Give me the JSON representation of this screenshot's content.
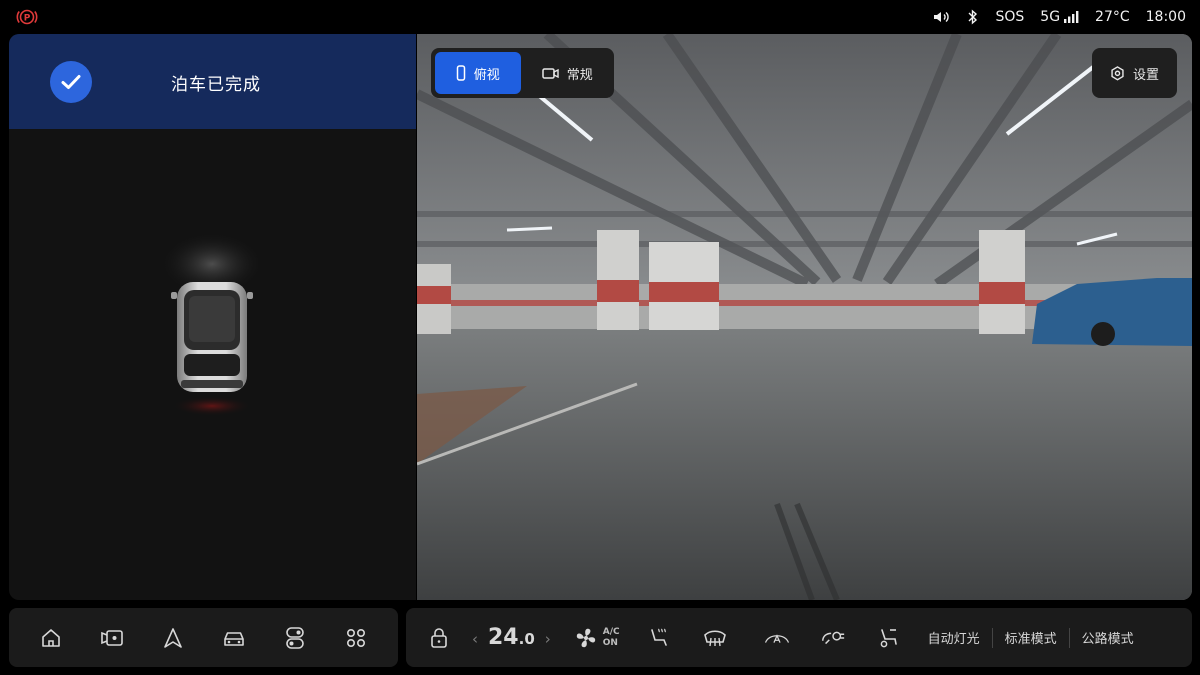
{
  "status": {
    "sos": "SOS",
    "network": "5G",
    "temperature": "27°C",
    "time": "18:00"
  },
  "banner": {
    "text": "泊车已完成"
  },
  "camera": {
    "view_tabs": [
      {
        "label": "俯视",
        "active": true,
        "icon": "phone-icon"
      },
      {
        "label": "常规",
        "active": false,
        "icon": "camera-icon"
      }
    ],
    "settings_label": "设置"
  },
  "dock_left": {
    "icons": [
      "home-icon",
      "dashcam-icon",
      "navigation-icon",
      "car-icon",
      "toggle-icon",
      "apps-grid-icon"
    ]
  },
  "dock_right": {
    "temperature_int": "24",
    "temperature_dec": ".0",
    "ac_line1": "A/C",
    "ac_line2": "ON",
    "auto_lights": "自动灯光",
    "standard_mode": "标准模式",
    "road_mode": "公路模式"
  },
  "colors": {
    "accent": "#1f5fe0",
    "banner_bg": "#152a5c",
    "parking_brake": "#e03a3a"
  }
}
